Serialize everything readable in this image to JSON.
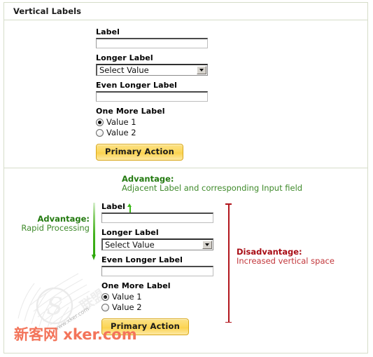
{
  "header": {
    "title": "Vertical Labels"
  },
  "form": {
    "fields": [
      {
        "label": "Label",
        "type": "text",
        "value": "",
        "placeholder": ""
      },
      {
        "label": "Longer Label",
        "type": "select",
        "value": "Select Value"
      },
      {
        "label": "Even Longer Label",
        "type": "text",
        "value": "",
        "placeholder": ""
      },
      {
        "label": "One More Label",
        "type": "radio-group"
      }
    ],
    "radio_options": [
      {
        "label": "Value 1",
        "checked": true
      },
      {
        "label": "Value 2",
        "checked": false
      }
    ],
    "primary_button": "Primary Action"
  },
  "annotations": {
    "advantage_top": {
      "title": "Advantage:",
      "text": "Adjacent Label and corresponding Input field",
      "color": "#237a10"
    },
    "advantage_left": {
      "title": "Advantage:",
      "text": "Rapid Processing",
      "color": "#237a10"
    },
    "disadvantage_right": {
      "title": "Disadvantage:",
      "text": "Increased vertical space",
      "color": "#a80d15"
    }
  },
  "watermark": {
    "text": "新客网 xker.com",
    "sub": "www.xker.com",
    "color": "#f3745a"
  },
  "colors": {
    "frame_border": "#d6ddc9",
    "button_gold": "#fbd24e",
    "green_arrow": "#2fa80c",
    "red_bracket": "#b2161d"
  }
}
